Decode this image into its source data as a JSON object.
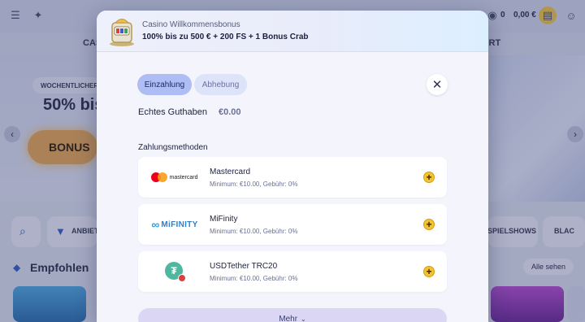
{
  "background": {
    "nav_items": [
      "CAS",
      "ORT"
    ],
    "wallet": {
      "coins": "0",
      "balance": "0,00 €",
      "notification_count": "1"
    },
    "hero": {
      "tag": "WOCHENTLICHER",
      "title": "50% bis",
      "button": "BONUS"
    },
    "filters": {
      "providers": "ANBIET",
      "live_shows": "SPIELSHOWS",
      "black": "BLAC"
    },
    "section": {
      "title": "Empfohlen",
      "see_all": "Alle sehen"
    }
  },
  "modal": {
    "bonus": {
      "label": "Casino Willkommensbonus",
      "value": "100% bis zu 500 € + 200 FS + 1 Bonus Crab"
    },
    "tabs": [
      {
        "label": "Einzahlung",
        "active": true
      },
      {
        "label": "Abhebung",
        "active": false
      }
    ],
    "close_icon": "close-icon",
    "balance": {
      "label": "Echtes Guthaben",
      "value": "€0.00"
    },
    "methods_label": "Zahlungsmethoden",
    "methods": [
      {
        "name": "Mastercard",
        "meta": "Minimum: €10.00, Gebühr: 0%",
        "logo_text": "mastercard"
      },
      {
        "name": "MiFinity",
        "meta": "Minimum: €10.00, Gebühr: 0%",
        "logo_text": "MiFINITY"
      },
      {
        "name": "USDTether TRC20",
        "meta": "Minimum: €10.00, Gebühr: 0%",
        "logo_text": "₮"
      }
    ],
    "add_symbol": "+",
    "more_label": "Mehr",
    "more_chevron": "⌄"
  },
  "colors": {
    "accent": "#aebdf3",
    "add_button": "#f2c233",
    "more_button": "#dcd6f5"
  }
}
